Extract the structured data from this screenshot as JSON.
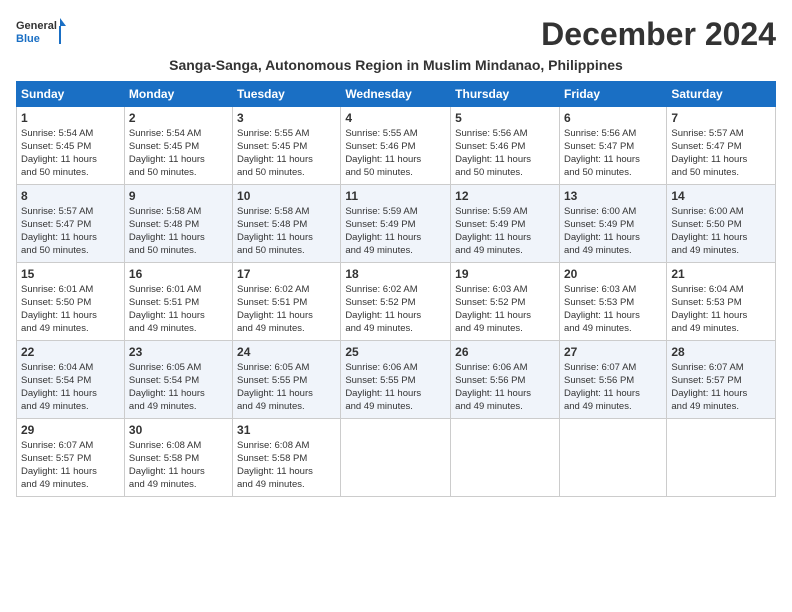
{
  "header": {
    "logo_general": "General",
    "logo_blue": "Blue",
    "month_title": "December 2024",
    "subtitle": "Sanga-Sanga, Autonomous Region in Muslim Mindanao, Philippines"
  },
  "weekdays": [
    "Sunday",
    "Monday",
    "Tuesday",
    "Wednesday",
    "Thursday",
    "Friday",
    "Saturday"
  ],
  "weeks": [
    [
      {
        "day": "1",
        "lines": [
          "Sunrise: 5:54 AM",
          "Sunset: 5:45 PM",
          "Daylight: 11 hours",
          "and 50 minutes."
        ]
      },
      {
        "day": "2",
        "lines": [
          "Sunrise: 5:54 AM",
          "Sunset: 5:45 PM",
          "Daylight: 11 hours",
          "and 50 minutes."
        ]
      },
      {
        "day": "3",
        "lines": [
          "Sunrise: 5:55 AM",
          "Sunset: 5:45 PM",
          "Daylight: 11 hours",
          "and 50 minutes."
        ]
      },
      {
        "day": "4",
        "lines": [
          "Sunrise: 5:55 AM",
          "Sunset: 5:46 PM",
          "Daylight: 11 hours",
          "and 50 minutes."
        ]
      },
      {
        "day": "5",
        "lines": [
          "Sunrise: 5:56 AM",
          "Sunset: 5:46 PM",
          "Daylight: 11 hours",
          "and 50 minutes."
        ]
      },
      {
        "day": "6",
        "lines": [
          "Sunrise: 5:56 AM",
          "Sunset: 5:47 PM",
          "Daylight: 11 hours",
          "and 50 minutes."
        ]
      },
      {
        "day": "7",
        "lines": [
          "Sunrise: 5:57 AM",
          "Sunset: 5:47 PM",
          "Daylight: 11 hours",
          "and 50 minutes."
        ]
      }
    ],
    [
      {
        "day": "8",
        "lines": [
          "Sunrise: 5:57 AM",
          "Sunset: 5:47 PM",
          "Daylight: 11 hours",
          "and 50 minutes."
        ]
      },
      {
        "day": "9",
        "lines": [
          "Sunrise: 5:58 AM",
          "Sunset: 5:48 PM",
          "Daylight: 11 hours",
          "and 50 minutes."
        ]
      },
      {
        "day": "10",
        "lines": [
          "Sunrise: 5:58 AM",
          "Sunset: 5:48 PM",
          "Daylight: 11 hours",
          "and 50 minutes."
        ]
      },
      {
        "day": "11",
        "lines": [
          "Sunrise: 5:59 AM",
          "Sunset: 5:49 PM",
          "Daylight: 11 hours",
          "and 49 minutes."
        ]
      },
      {
        "day": "12",
        "lines": [
          "Sunrise: 5:59 AM",
          "Sunset: 5:49 PM",
          "Daylight: 11 hours",
          "and 49 minutes."
        ]
      },
      {
        "day": "13",
        "lines": [
          "Sunrise: 6:00 AM",
          "Sunset: 5:49 PM",
          "Daylight: 11 hours",
          "and 49 minutes."
        ]
      },
      {
        "day": "14",
        "lines": [
          "Sunrise: 6:00 AM",
          "Sunset: 5:50 PM",
          "Daylight: 11 hours",
          "and 49 minutes."
        ]
      }
    ],
    [
      {
        "day": "15",
        "lines": [
          "Sunrise: 6:01 AM",
          "Sunset: 5:50 PM",
          "Daylight: 11 hours",
          "and 49 minutes."
        ]
      },
      {
        "day": "16",
        "lines": [
          "Sunrise: 6:01 AM",
          "Sunset: 5:51 PM",
          "Daylight: 11 hours",
          "and 49 minutes."
        ]
      },
      {
        "day": "17",
        "lines": [
          "Sunrise: 6:02 AM",
          "Sunset: 5:51 PM",
          "Daylight: 11 hours",
          "and 49 minutes."
        ]
      },
      {
        "day": "18",
        "lines": [
          "Sunrise: 6:02 AM",
          "Sunset: 5:52 PM",
          "Daylight: 11 hours",
          "and 49 minutes."
        ]
      },
      {
        "day": "19",
        "lines": [
          "Sunrise: 6:03 AM",
          "Sunset: 5:52 PM",
          "Daylight: 11 hours",
          "and 49 minutes."
        ]
      },
      {
        "day": "20",
        "lines": [
          "Sunrise: 6:03 AM",
          "Sunset: 5:53 PM",
          "Daylight: 11 hours",
          "and 49 minutes."
        ]
      },
      {
        "day": "21",
        "lines": [
          "Sunrise: 6:04 AM",
          "Sunset: 5:53 PM",
          "Daylight: 11 hours",
          "and 49 minutes."
        ]
      }
    ],
    [
      {
        "day": "22",
        "lines": [
          "Sunrise: 6:04 AM",
          "Sunset: 5:54 PM",
          "Daylight: 11 hours",
          "and 49 minutes."
        ]
      },
      {
        "day": "23",
        "lines": [
          "Sunrise: 6:05 AM",
          "Sunset: 5:54 PM",
          "Daylight: 11 hours",
          "and 49 minutes."
        ]
      },
      {
        "day": "24",
        "lines": [
          "Sunrise: 6:05 AM",
          "Sunset: 5:55 PM",
          "Daylight: 11 hours",
          "and 49 minutes."
        ]
      },
      {
        "day": "25",
        "lines": [
          "Sunrise: 6:06 AM",
          "Sunset: 5:55 PM",
          "Daylight: 11 hours",
          "and 49 minutes."
        ]
      },
      {
        "day": "26",
        "lines": [
          "Sunrise: 6:06 AM",
          "Sunset: 5:56 PM",
          "Daylight: 11 hours",
          "and 49 minutes."
        ]
      },
      {
        "day": "27",
        "lines": [
          "Sunrise: 6:07 AM",
          "Sunset: 5:56 PM",
          "Daylight: 11 hours",
          "and 49 minutes."
        ]
      },
      {
        "day": "28",
        "lines": [
          "Sunrise: 6:07 AM",
          "Sunset: 5:57 PM",
          "Daylight: 11 hours",
          "and 49 minutes."
        ]
      }
    ],
    [
      {
        "day": "29",
        "lines": [
          "Sunrise: 6:07 AM",
          "Sunset: 5:57 PM",
          "Daylight: 11 hours",
          "and 49 minutes."
        ]
      },
      {
        "day": "30",
        "lines": [
          "Sunrise: 6:08 AM",
          "Sunset: 5:58 PM",
          "Daylight: 11 hours",
          "and 49 minutes."
        ]
      },
      {
        "day": "31",
        "lines": [
          "Sunrise: 6:08 AM",
          "Sunset: 5:58 PM",
          "Daylight: 11 hours",
          "and 49 minutes."
        ]
      },
      null,
      null,
      null,
      null
    ]
  ]
}
